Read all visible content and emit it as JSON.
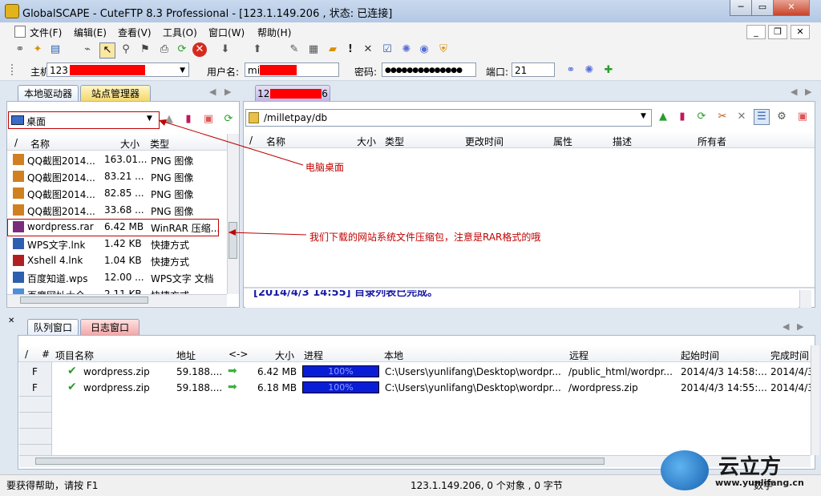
{
  "window": {
    "title": "GlobalSCAPE - CuteFTP 8.3 Professional - [123.1.149.206 , 状态: 已连接]"
  },
  "menu": [
    "文件(F)",
    "编辑(E)",
    "查看(V)",
    "工具(O)",
    "窗口(W)",
    "帮助(H)"
  ],
  "connection": {
    "host_label": "主机:",
    "host_value": "123",
    "user_label": "用户名:",
    "user_value": "mi",
    "pass_label": "密码:",
    "pass_value": "●●●●●●●●●●●●●●",
    "port_label": "端口:",
    "port_value": "21"
  },
  "left_pane": {
    "tabs": [
      "本地驱动器",
      "站点管理器"
    ],
    "location": "桌面",
    "columns": [
      "/",
      "名称",
      "大小",
      "类型"
    ],
    "files": [
      {
        "name": "QQ截图2014...",
        "size": "163.01...",
        "type": "PNG 图像"
      },
      {
        "name": "QQ截图2014...",
        "size": "83.21 ...",
        "type": "PNG 图像"
      },
      {
        "name": "QQ截图2014...",
        "size": "82.85 ...",
        "type": "PNG 图像"
      },
      {
        "name": "QQ截图2014...",
        "size": "33.68 ...",
        "type": "PNG 图像"
      },
      {
        "name": "wordpress.rar",
        "size": "6.42 MB",
        "type": "WinRAR 压缩..."
      },
      {
        "name": "WPS文字.lnk",
        "size": "1.42 KB",
        "type": "快捷方式"
      },
      {
        "name": "Xshell 4.lnk",
        "size": "1.04 KB",
        "type": "快捷方式"
      },
      {
        "name": "百度知道.wps",
        "size": "12.00 ...",
        "type": "WPS文字 文档"
      },
      {
        "name": "百度网址大全",
        "size": "2.11 KB",
        "type": "快捷方式"
      }
    ]
  },
  "right_pane": {
    "tab": "123.1.149.206",
    "path": "/milletpay/db",
    "columns": [
      "/",
      "名称",
      "大小",
      "类型",
      "更改时间",
      "属性",
      "描述",
      "所有者"
    ],
    "log_partial": "[2014/4/3 14:55] 目录列表已完成。"
  },
  "annotations": {
    "desktop": "电脑桌面",
    "rar": "我们下载的网站系统文件压缩包，注意是RAR格式的哦"
  },
  "queue": {
    "tabs": [
      "队列窗口",
      "日志窗口"
    ],
    "columns": [
      "/",
      "#",
      "项目名称",
      "地址",
      "<->",
      "大小",
      "进程",
      "本地",
      "远程",
      "起始时间",
      "完成时间"
    ],
    "rows": [
      {
        "flag": "F",
        "name": "wordpress.zip",
        "address": "59.188....",
        "size": "6.42 MB",
        "progress": "100%",
        "progress_value": 100,
        "local": "C:\\Users\\yunlifang\\Desktop\\wordpr...",
        "remote": "/public_html/wordpr...",
        "start": "2014/4/3 14:58:...",
        "finish": "2014/4/3"
      },
      {
        "flag": "F",
        "name": "wordpress.zip",
        "address": "59.188....",
        "size": "6.18 MB",
        "progress": "100%",
        "progress_value": 100,
        "local": "C:\\Users\\yunlifang\\Desktop\\wordpr...",
        "remote": "/wordpress.zip",
        "start": "2014/4/3 14:55:...",
        "finish": "2014/4/3"
      }
    ]
  },
  "status": {
    "help": "要获得帮助，请按 F1",
    "info": "123.1.149.206, 0 个对象 , 0 字节",
    "num": "数字"
  },
  "watermark": {
    "brand": "云立方",
    "url": "www.yunlifang.cn"
  },
  "colors": {
    "annotation": "#c00000",
    "progress": "#0a1dd6",
    "check": "#2a9d2a",
    "arrow": "#3cb043"
  }
}
